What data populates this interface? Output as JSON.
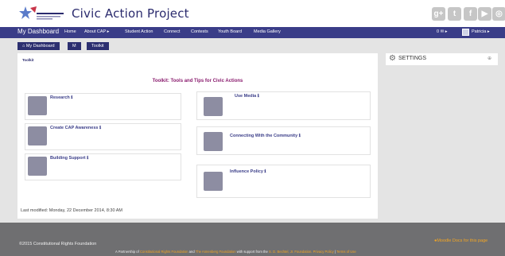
{
  "header": {
    "site_title": "Civic Action Project",
    "social_icons": [
      "google-plus-icon",
      "twitter-icon",
      "facebook-icon",
      "youtube-icon",
      "instagram-icon"
    ]
  },
  "navbar": {
    "brand": "My Dashboard",
    "items": [
      "Home",
      "About CAP ▸",
      "Student Action",
      "Connect",
      "Contests",
      "Youth Board",
      "Media Gallery"
    ],
    "message_count": "0 ✉ ▸",
    "user": "Patricia ▸"
  },
  "breadcrumb": [
    "⌂ My Dashboard",
    "M",
    "Toolkit"
  ],
  "main": {
    "heading": "Toolkit",
    "title": "Toolkit: Tools and Tips for Civic Actions",
    "tiles": [
      "Research ℹ",
      "Create CAP Awareness ℹ",
      "Building Support ℹ",
      "Use Media ℹ",
      "Connecting With the Community ℹ",
      "Influence Policy ℹ"
    ],
    "last_modified": "Last modified: Monday, 22 December 2014, 8:30 AM"
  },
  "settings": {
    "label": "SETTINGS",
    "collapse": "⊕"
  },
  "footer": {
    "copyright": "©2015 Constitutional Rights Foundation",
    "partner_prefix": "A Partnership of",
    "partner_crf": "Constitutional Rights Foundation",
    "partner_and": "and",
    "partner_annenberg": "The Annenberg Foundation",
    "partner_support": "with support from the",
    "partner_bechtel": "S. D. Bechtel, Jr. Foundation.",
    "privacy": "Privacy Policy",
    "separator": "|",
    "terms": "Terms of Use",
    "moodle_docs": "Moodle Docs for this page"
  },
  "colors": {
    "navbar": "#3a3d88",
    "title": "#8a1c6e",
    "footer": "#6f6f71",
    "accent": "#f4a623"
  }
}
